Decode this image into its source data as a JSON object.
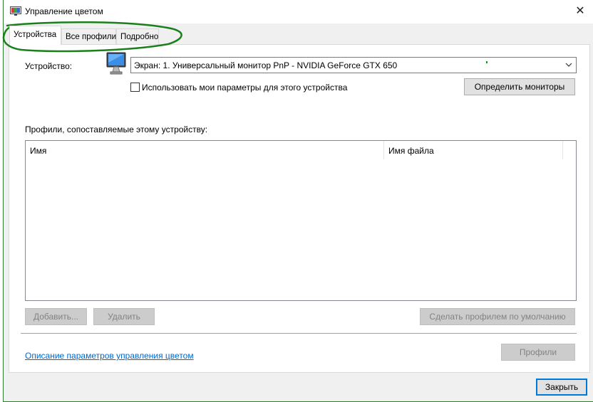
{
  "window": {
    "title": "Управление цветом",
    "icon": "color-management-icon",
    "close_icon": "✕"
  },
  "tabs": [
    {
      "label": "Устройства",
      "active": true
    },
    {
      "label": "Все профили",
      "active": false
    },
    {
      "label": "Подробно",
      "active": false
    }
  ],
  "device": {
    "label": "Устройство:",
    "icon": "monitor-icon",
    "selected": "Экран: 1. Универсальный монитор PnP - NVIDIA GeForce GTX 650",
    "checkbox_label": "Использовать мои параметры для этого устройства",
    "checkbox_checked": false,
    "identify_button": "Определить мониторы"
  },
  "profiles": {
    "label": "Профили, сопоставляемые этому устройству:",
    "columns": [
      "Имя",
      "Имя файла"
    ],
    "rows": [],
    "add_button": "Добавить...",
    "remove_button": "Удалить",
    "set_default_button": "Сделать профилем по умолчанию"
  },
  "footer": {
    "link": "Описание параметров управления цветом",
    "profiles_button": "Профили",
    "close_button": "Закрыть"
  },
  "colors": {
    "accent": "#0078d7",
    "link": "#0066cc",
    "annotation": "#1b7f1b"
  }
}
